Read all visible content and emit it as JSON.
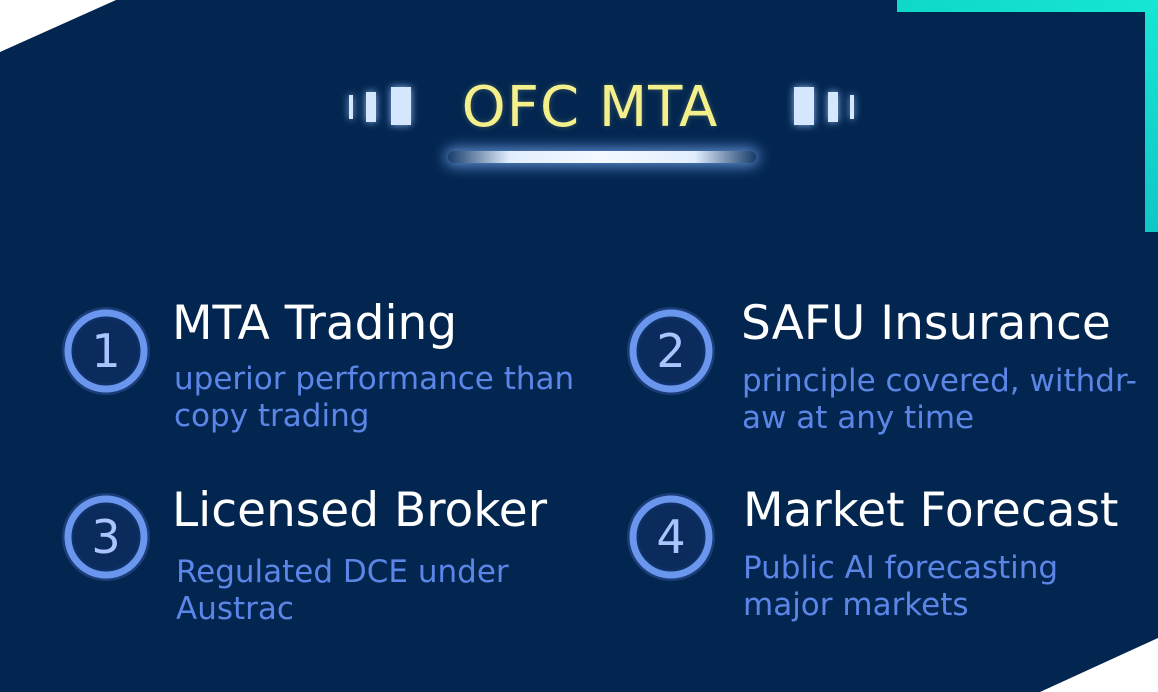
{
  "title": "OFC MTA",
  "colors": {
    "background": "#032650",
    "accent_teal": "#17e6d4",
    "title": "#f4f08c",
    "feature_title": "#ffffff",
    "feature_desc": "#5b86e8",
    "badge_ring": "#5f8de8"
  },
  "features": [
    {
      "number": "1",
      "title": "MTA Trading",
      "description": "uperior performance than\ncopy trading"
    },
    {
      "number": "2",
      "title": "SAFU Insurance",
      "description": "principle covered, withdr-\naw at any time"
    },
    {
      "number": "3",
      "title": "Licensed Broker",
      "description": "Regulated DCE under\nAustrac"
    },
    {
      "number": "4",
      "title": "Market Forecast",
      "description": "Public AI forecasting\nmajor markets"
    }
  ]
}
